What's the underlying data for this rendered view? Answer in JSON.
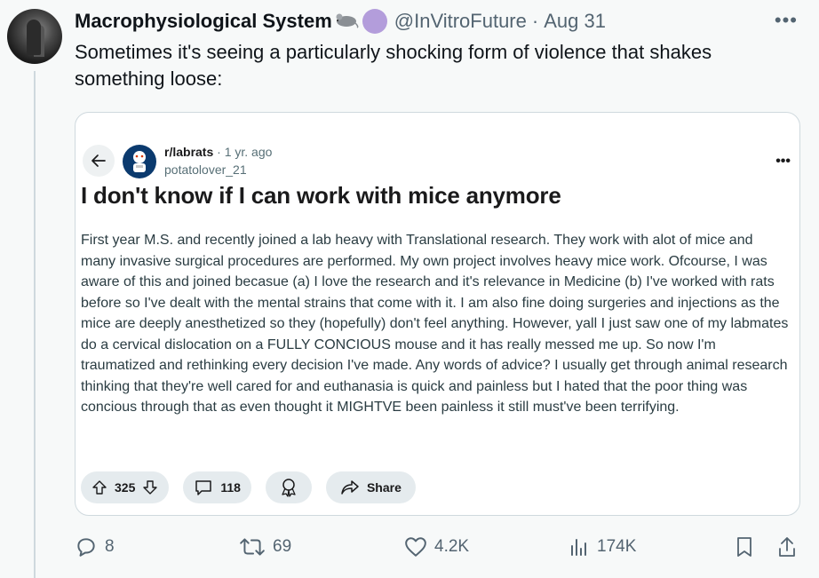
{
  "tweet": {
    "display_name": "Macrophysiological System",
    "handle": "@InVitroFuture",
    "separator": "·",
    "date": "Aug 31",
    "more": "•••",
    "text": "Sometimes it's seeing a particularly shocking form of violence that shakes something loose:"
  },
  "embedded_post": {
    "subreddit": "r/labrats",
    "meta": "· 1 yr. ago",
    "username": "potatolover_21",
    "more": "•••",
    "title": "I don't know if I can work with mice anymore",
    "body": "First year M.S. and recently joined a lab heavy with Translational research. They work with alot of mice and many invasive surgical procedures are performed. My own project involves heavy mice work. Ofcourse, I was aware of this and joined becasue (a) I love the research and it's relevance in Medicine (b) I've worked with rats before so I've dealt with the mental strains that come with it. I am also fine doing surgeries and injections as the mice are deeply anesthetized so they (hopefully) don't feel anything. However, yall I just saw one of my labmates do a cervical dislocation on a FULLY CONCIOUS mouse and it has really messed me up. So now I'm traumatized and rethinking every decision I've made. Any words of advice? I usually get through animal research thinking that they're well cared for and euthanasia is quick and painless but I hated that the poor thing was concious through that as even thought it MIGHTVE been painless it still must've been terrifying.",
    "votes": "325",
    "comments": "118",
    "share_label": "Share"
  },
  "stats": {
    "replies": "8",
    "retweets": "69",
    "likes": "4.2K",
    "views": "174K"
  },
  "icons": {
    "reply": "reply-icon",
    "retweet": "retweet-icon",
    "like": "heart-icon",
    "views": "views-icon",
    "bookmark": "bookmark-icon",
    "share": "share-icon"
  },
  "colors": {
    "muted": "#536471",
    "badge": "#b39ddb",
    "pill": "#e5ebee"
  }
}
